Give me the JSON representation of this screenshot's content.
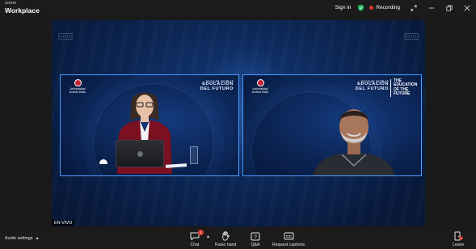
{
  "app": {
    "brand_line1": "zoom",
    "brand_line2": "Workplace"
  },
  "titlebar": {
    "sign_in_label": "Sign in",
    "shield_icon": "shield-check-icon",
    "recording_label": "Recording",
    "icons": [
      "fullscreen-icon",
      "minimize-icon",
      "restore-icon",
      "close-icon"
    ]
  },
  "stage": {
    "tile1": {
      "logo_text": "Universidad Andrés Bello",
      "edu_small": "CICLO DE CHARLAS",
      "edu_big_line1": "EDUCACIÓN",
      "edu_big_line2": "DEL FUTURO"
    },
    "tile2": {
      "logo_text": "Universidad Andrés Bello",
      "edu_small": "CICLO DE CHARLAS",
      "edu_big_line1": "EDUCACIÓN",
      "edu_big_line2": "DEL FUTURO",
      "future_line1": "THE EDUCATION",
      "future_line2": "OF THE FUTURE"
    },
    "live_label": "EN VIVO"
  },
  "toolbar": {
    "audio_settings_label": "Audio settings",
    "chat_label": "Chat",
    "chat_badge": "1",
    "raise_hand_label": "Raise hand",
    "qa_label": "Q&A",
    "captions_label": "Request captions",
    "leave_label": "Leave"
  },
  "colors": {
    "recording_dot": "#e0382e",
    "shield_green": "#1fae5b",
    "tile_border": "#4a9cff",
    "leave_red": "#e0382e"
  }
}
